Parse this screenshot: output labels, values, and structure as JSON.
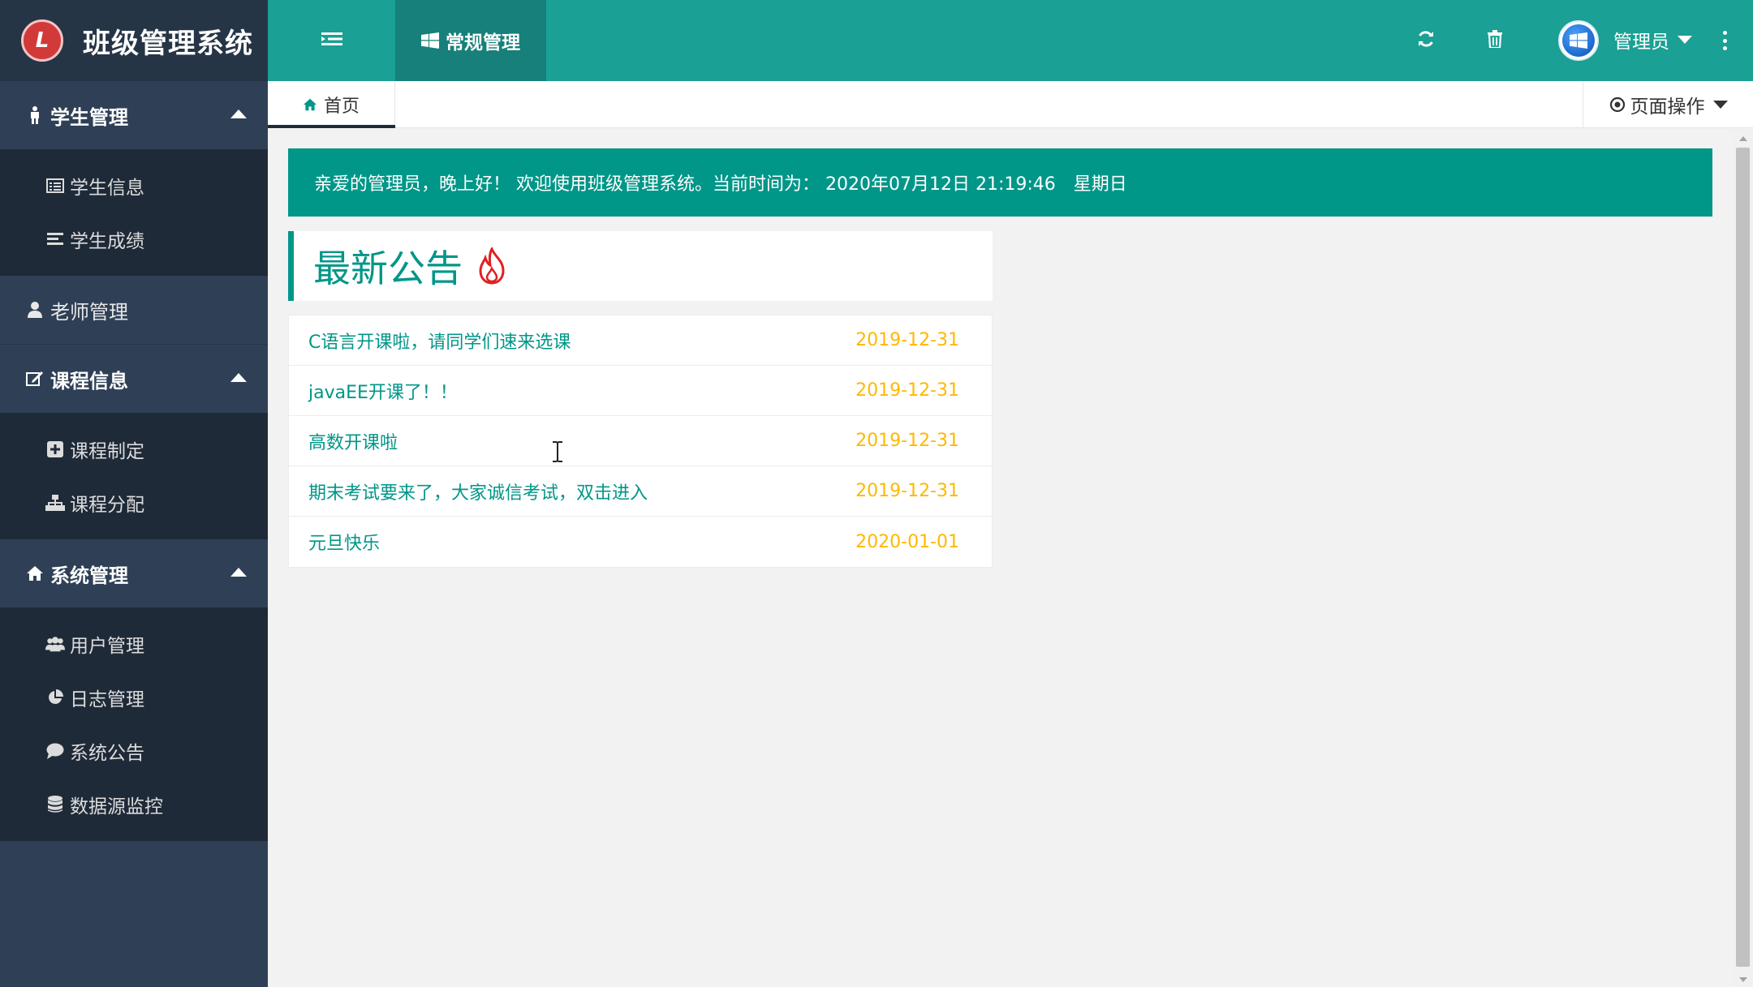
{
  "app": {
    "logo_text": "L",
    "title": "班级管理系统"
  },
  "sidebar": {
    "groups": [
      {
        "label": "学生管理",
        "expanded": true,
        "items": [
          {
            "label": "学生信息",
            "icon": "list-alt-icon"
          },
          {
            "label": "学生成绩",
            "icon": "align-left-icon"
          }
        ]
      },
      {
        "label": "老师管理",
        "expanded": false,
        "items": []
      },
      {
        "label": "课程信息",
        "expanded": true,
        "items": [
          {
            "label": "课程制定",
            "icon": "plus-square-icon"
          },
          {
            "label": "课程分配",
            "icon": "sitemap-icon"
          }
        ]
      },
      {
        "label": "系统管理",
        "expanded": true,
        "items": [
          {
            "label": "用户管理",
            "icon": "users-icon"
          },
          {
            "label": "日志管理",
            "icon": "pie-chart-icon"
          },
          {
            "label": "系统公告",
            "icon": "comment-icon"
          },
          {
            "label": "数据源监控",
            "icon": "database-icon"
          }
        ]
      }
    ]
  },
  "topbar": {
    "tab_label": "常规管理",
    "user_name": "管理员"
  },
  "tabs": {
    "home_label": "首页",
    "page_ops_label": "页面操作"
  },
  "welcome": {
    "text": "亲爱的管理员，晚上好！ 欢迎使用班级管理系统。当前时间为： 2020年07月12日 21:19:46　星期日"
  },
  "notices": {
    "title": "最新公告",
    "items": [
      {
        "text": "C语言开课啦，请同学们速来选课",
        "date": "2019-12-31"
      },
      {
        "text": "javaEE开课了！！",
        "date": "2019-12-31"
      },
      {
        "text": "高数开课啦",
        "date": "2019-12-31"
      },
      {
        "text": "期末考试要来了，大家诚信考试，双击进入",
        "date": "2019-12-31"
      },
      {
        "text": "元旦快乐",
        "date": "2020-01-01"
      }
    ]
  },
  "colors": {
    "sidebar_bg": "#2f4056",
    "topbar_bg": "#1aa094",
    "accent": "#009688",
    "date": "#ffb800"
  }
}
